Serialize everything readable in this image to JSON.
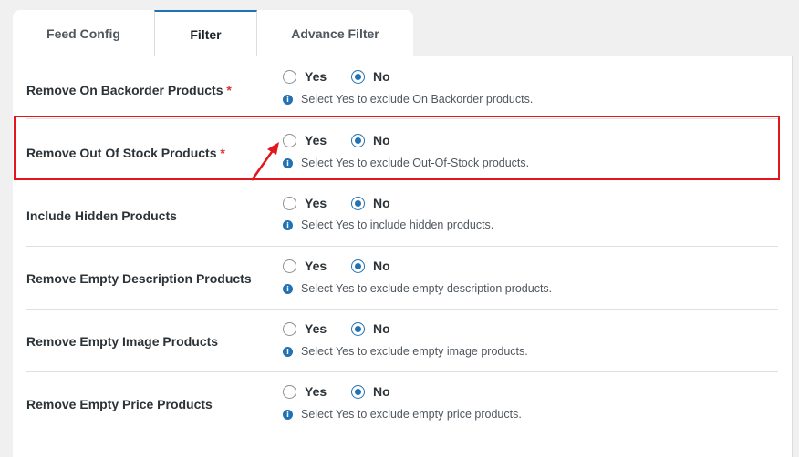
{
  "tabs": [
    {
      "label": "Feed Config",
      "active": false
    },
    {
      "label": "Filter",
      "active": true
    },
    {
      "label": "Advance Filter",
      "active": false
    }
  ],
  "options": {
    "yes": "Yes",
    "no": "No"
  },
  "required_mark": "*",
  "rows": [
    {
      "label": "Remove On Backorder Products",
      "required": true,
      "selected": "No",
      "help": "Select Yes to exclude On Backorder products."
    },
    {
      "label": "Remove Out Of Stock Products",
      "required": true,
      "selected": "No",
      "help": "Select Yes to exclude Out-Of-Stock products.",
      "highlighted": true
    },
    {
      "label": "Include Hidden Products",
      "required": false,
      "selected": "No",
      "help": "Select Yes to include hidden products."
    },
    {
      "label": "Remove Empty Description Products",
      "required": false,
      "selected": "No",
      "help": "Select Yes to exclude empty description products."
    },
    {
      "label": "Remove Empty Image Products",
      "required": false,
      "selected": "No",
      "help": "Select Yes to exclude empty image products."
    },
    {
      "label": "Remove Empty Price Products",
      "required": false,
      "selected": "No",
      "help": "Select Yes to exclude empty price products."
    }
  ],
  "colors": {
    "accent": "#2271b1",
    "annotation": "#e1171d",
    "required": "#d63638"
  }
}
